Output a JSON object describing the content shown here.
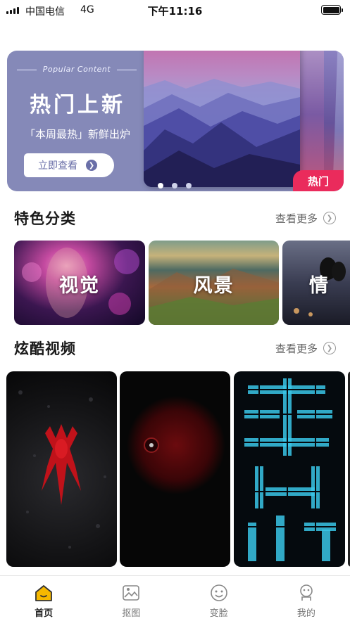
{
  "status_bar": {
    "carrier": "中国电信",
    "network": "4G",
    "time": "下午11:16"
  },
  "banner": {
    "subtitle_en": "Popular Content",
    "title": "热门上新",
    "tagline": "「本周最热」新鲜出炉",
    "button_label": "立即查看",
    "tag": "热门",
    "carousel_active_index": 0,
    "carousel_count": 3
  },
  "featured_categories": {
    "title": "特色分类",
    "more_label": "查看更多",
    "items": [
      {
        "label": "视觉"
      },
      {
        "label": "风景"
      },
      {
        "label": "情"
      }
    ]
  },
  "cool_videos": {
    "title": "炫酷视频",
    "more_label": "查看更多"
  },
  "tabbar": {
    "active_color": "#f5b800",
    "items": [
      {
        "label": "首页",
        "icon": "home-icon",
        "active": true
      },
      {
        "label": "抠图",
        "icon": "image-icon",
        "active": false
      },
      {
        "label": "变脸",
        "icon": "face-icon",
        "active": false
      },
      {
        "label": "我的",
        "icon": "profile-icon",
        "active": false
      }
    ]
  }
}
